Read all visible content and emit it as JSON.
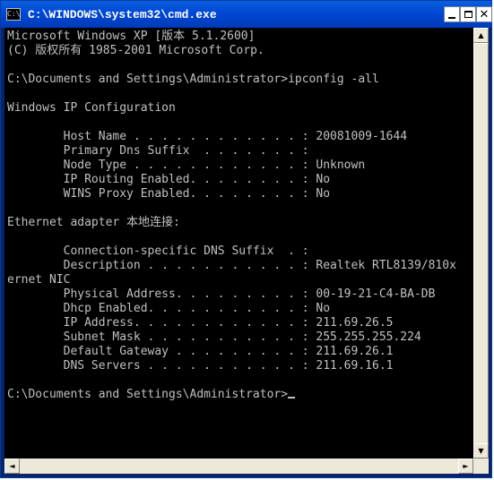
{
  "window": {
    "title": "C:\\WINDOWS\\system32\\cmd.exe",
    "icon": "console-icon",
    "icon_text": "C:\\",
    "buttons": {
      "minimize": "minimize-icon",
      "maximize": "maximize-icon",
      "close": "close-icon"
    }
  },
  "console": {
    "lines": [
      "Microsoft Windows XP [版本 5.1.2600]",
      "(C) 版权所有 1985-2001 Microsoft Corp.",
      "",
      "C:\\Documents and Settings\\Administrator>ipconfig -all",
      "",
      "Windows IP Configuration",
      "",
      "        Host Name . . . . . . . . . . . . : 20081009-1644",
      "        Primary Dns Suffix  . . . . . . . :",
      "        Node Type . . . . . . . . . . . . : Unknown",
      "        IP Routing Enabled. . . . . . . . : No",
      "        WINS Proxy Enabled. . . . . . . . : No",
      "",
      "Ethernet adapter 本地连接:",
      "",
      "        Connection-specific DNS Suffix  . :",
      "        Description . . . . . . . . . . . : Realtek RTL8139/810x",
      "ernet NIC",
      "        Physical Address. . . . . . . . . : 00-19-21-C4-BA-DB",
      "        Dhcp Enabled. . . . . . . . . . . : No",
      "        IP Address. . . . . . . . . . . . : 211.69.26.5",
      "        Subnet Mask . . . . . . . . . . . : 255.255.255.224",
      "        Default Gateway . . . . . . . . . : 211.69.26.1",
      "        DNS Servers . . . . . . . . . . . : 211.69.16.1",
      "",
      "C:\\Documents and Settings\\Administrator>"
    ]
  },
  "scrollbars": {
    "up": "▲",
    "down": "▼",
    "left": "◄",
    "right": "►"
  }
}
